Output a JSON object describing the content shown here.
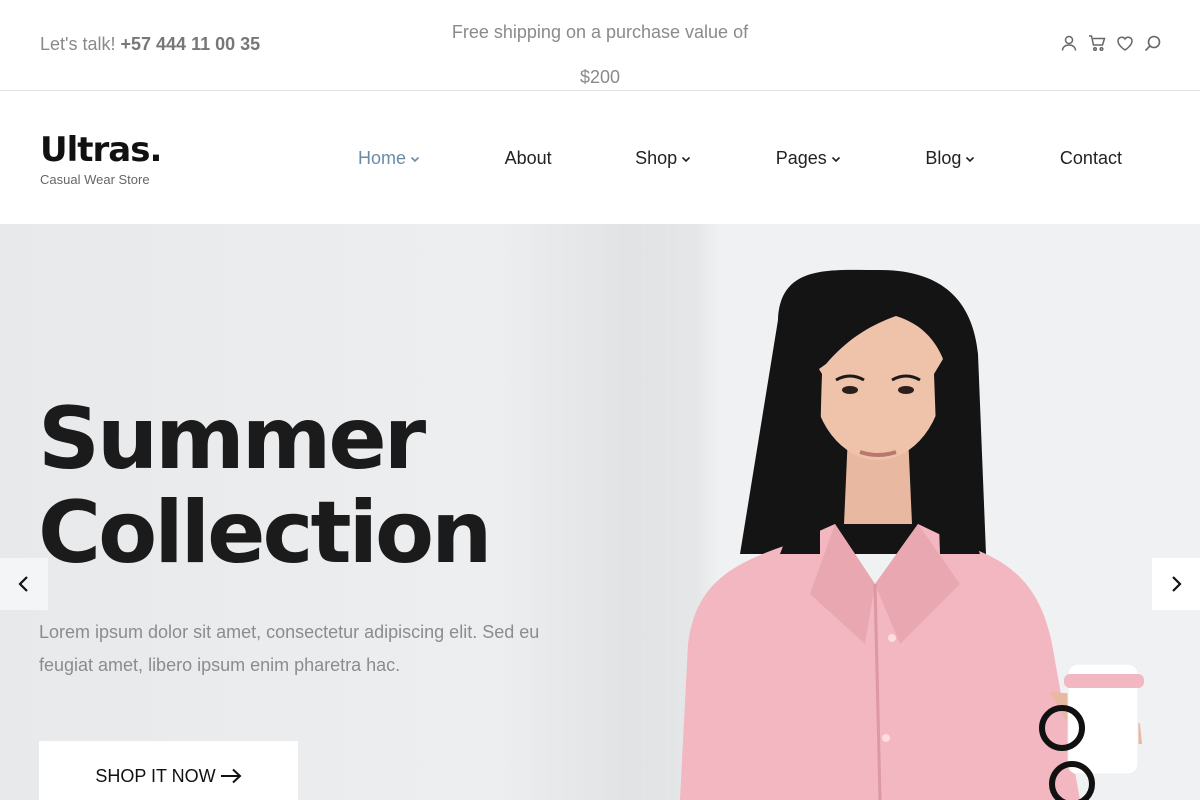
{
  "topbar": {
    "talk_label": "Let's talk!",
    "phone": "+57 444 11 00 35",
    "shipping_line1": "Free shipping on a purchase value of",
    "shipping_line2": "$200",
    "icons": [
      "user-icon",
      "cart-icon",
      "heart-icon",
      "search-icon"
    ]
  },
  "header": {
    "logo": "Ultras.",
    "tagline": "Casual Wear Store",
    "nav": [
      {
        "label": "Home",
        "dropdown": true,
        "active": true
      },
      {
        "label": "About",
        "dropdown": false
      },
      {
        "label": "Shop",
        "dropdown": true
      },
      {
        "label": "Pages",
        "dropdown": true
      },
      {
        "label": "Blog",
        "dropdown": true
      },
      {
        "label": "Contact",
        "dropdown": false
      }
    ]
  },
  "hero": {
    "title_line1": "Summer",
    "title_line2": "Collection",
    "description": "Lorem ipsum dolor sit amet, consectetur adipiscing elit. Sed eu feugiat amet, libero ipsum enim pharetra hac.",
    "button_label": "SHOP IT NOW",
    "prev_icon": "chevron-left-icon",
    "next_icon": "chevron-right-icon"
  },
  "colors": {
    "accent": "#6a8ba6",
    "text_dark": "#1b1b1b",
    "text_muted": "#8c8c8c",
    "shirt_pink": "#f2b7c0"
  }
}
